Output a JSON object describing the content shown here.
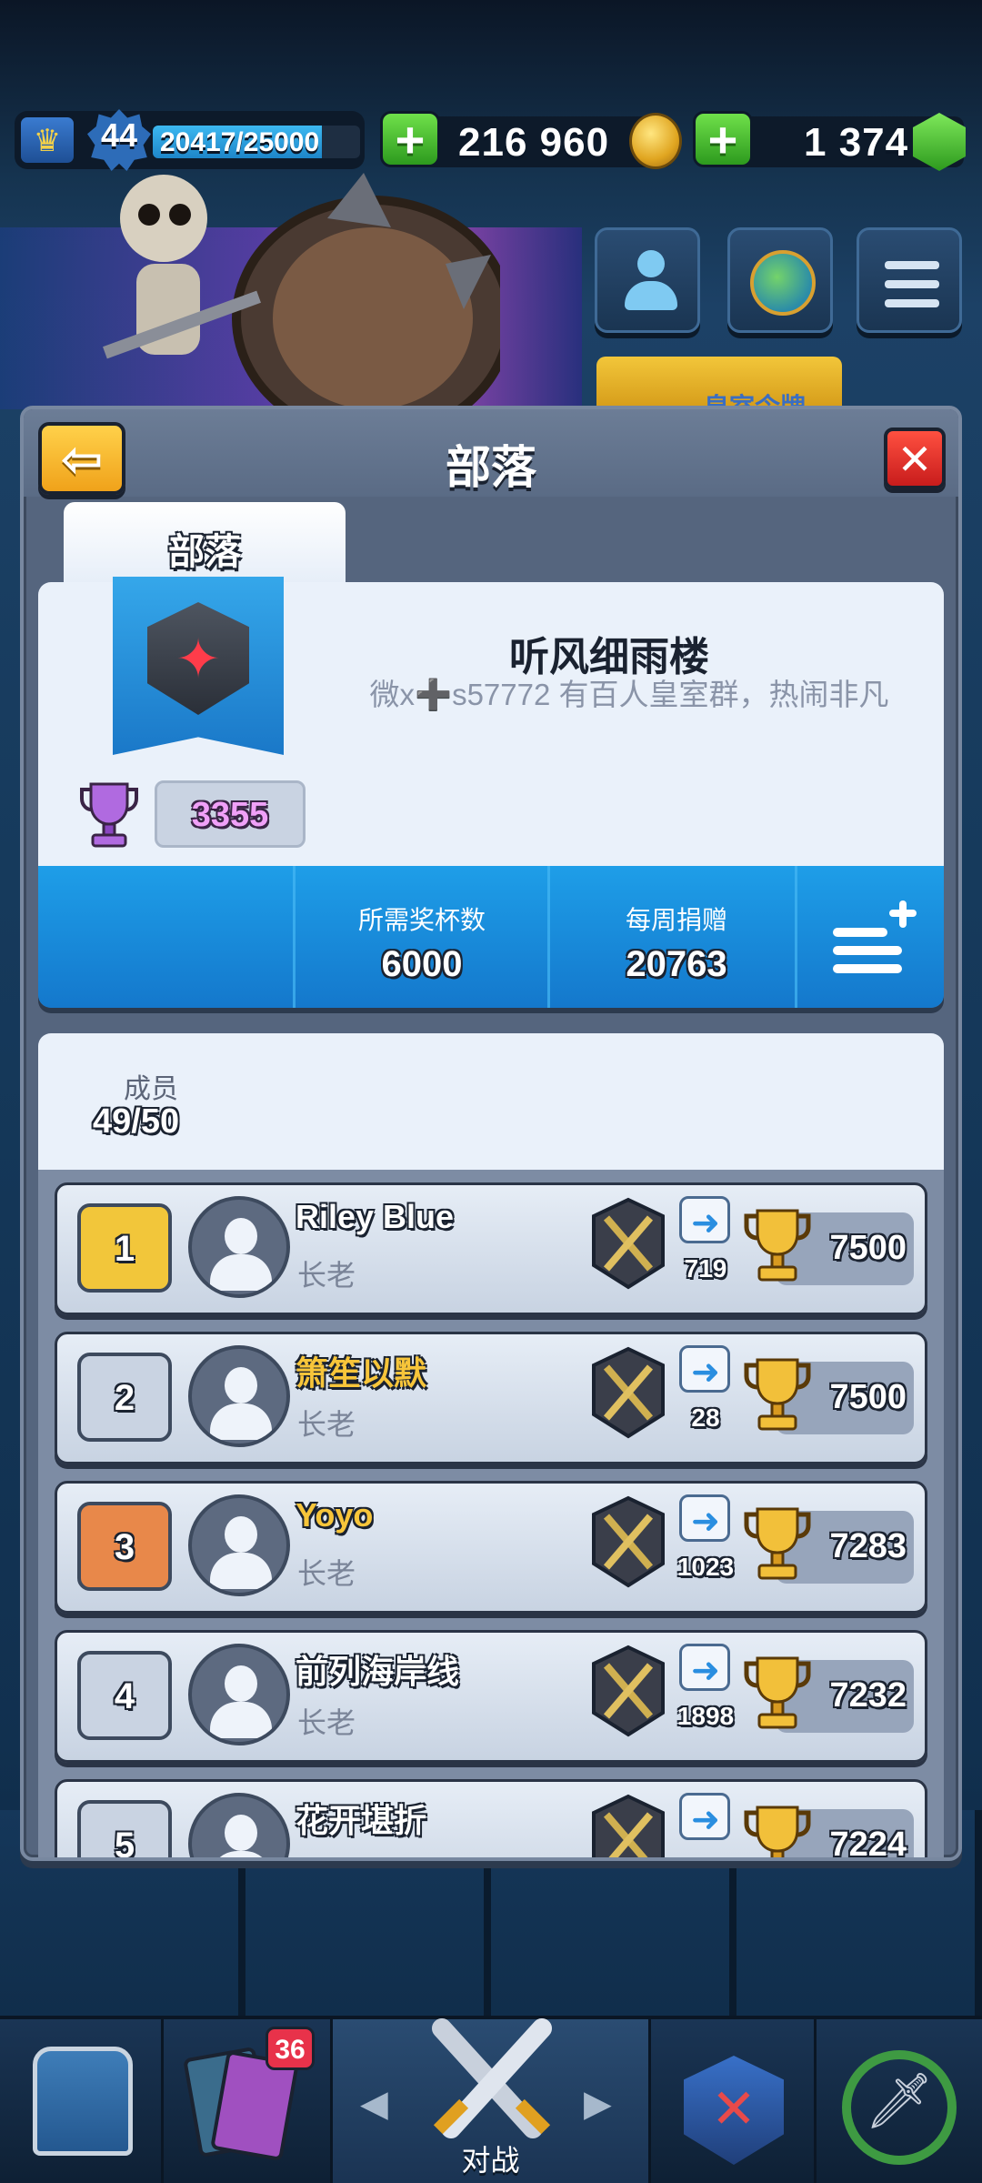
{
  "top_bar": {
    "level": "44",
    "xp_text": "20417/25000",
    "xp_progress": 0.8167,
    "gold": "216 960",
    "gems": "1 374"
  },
  "side_buttons": [
    "friends-icon",
    "royale-globe-icon",
    "menu-icon"
  ],
  "royal_tag_text": "皇室令牌",
  "panel": {
    "title": "部落",
    "tab_label": "部落"
  },
  "clan": {
    "name": "听风细雨楼",
    "description": "微x➕s57772 有百人皇室群，热闹非凡",
    "trophies": "3355",
    "required_trophies_label": "所需奖杯数",
    "required_trophies": "6000",
    "weekly_donations_label": "每周捐赠",
    "weekly_donations": "20763"
  },
  "members": {
    "label": "成员",
    "count": "49/50",
    "rows": [
      {
        "rank": "1",
        "name": "Riley Blue",
        "role": "长老",
        "donations": "719",
        "trophies": "7500",
        "rank_color": "#f2c63a",
        "name_color": "#ffffff",
        "league_icon": "crossed-swords-gold-icon"
      },
      {
        "rank": "2",
        "name": "箫笙以默",
        "role": "长老",
        "donations": "28",
        "trophies": "7500",
        "rank_color": "#c9d3e2",
        "name_color": "#f7c53a",
        "league_icon": "crossed-swords-silver-icon"
      },
      {
        "rank": "3",
        "name": "Yoyo",
        "role": "长老",
        "donations": "1023",
        "trophies": "7283",
        "rank_color": "#e8884a",
        "name_color": "#f7c53a",
        "league_icon": "hammer-shield-icon"
      },
      {
        "rank": "4",
        "name": "前列海岸线",
        "role": "长老",
        "donations": "1898",
        "trophies": "7232",
        "rank_color": "#c9d3e2",
        "name_color": "#ffffff",
        "league_icon": "knight-shield-icon"
      },
      {
        "rank": "5",
        "name": "花开堪折",
        "role": "",
        "donations": "",
        "trophies": "7224",
        "rank_color": "#c9d3e2",
        "name_color": "#ffffff",
        "league_icon": "knight-shield-icon"
      }
    ]
  },
  "bottom_nav": {
    "cards_badge": "36",
    "battle_label": "对战",
    "items": [
      "shop-chest-icon",
      "cards-icon",
      "battle-swords-icon",
      "clan-icon",
      "events-icon"
    ]
  }
}
